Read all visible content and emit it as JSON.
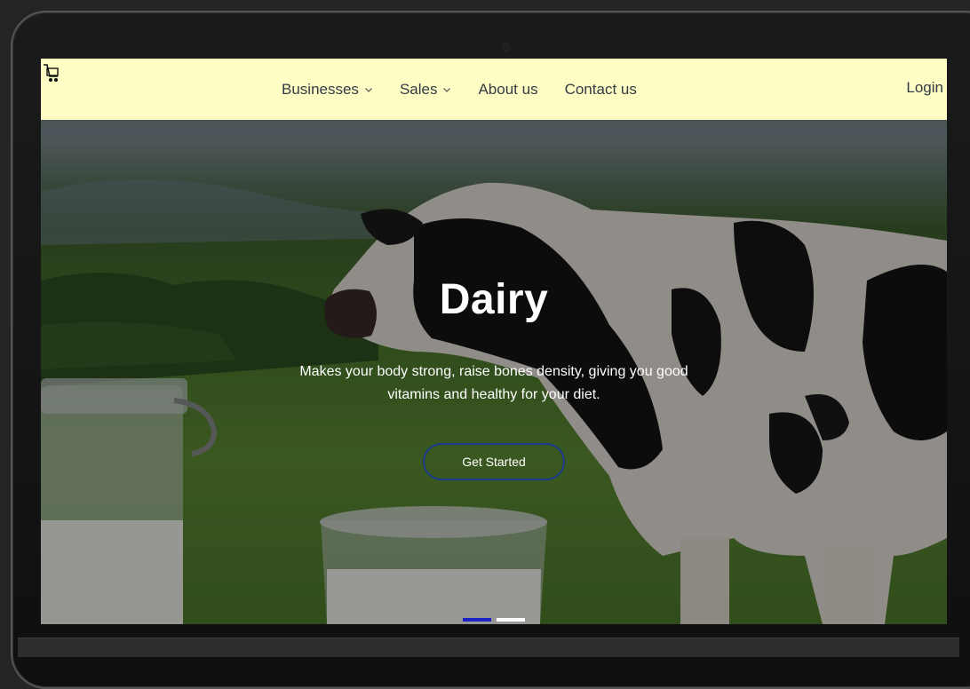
{
  "nav": {
    "items": [
      {
        "label": "Businesses",
        "has_dropdown": true
      },
      {
        "label": "Sales",
        "has_dropdown": true
      },
      {
        "label": "About us",
        "has_dropdown": false
      },
      {
        "label": "Contact us",
        "has_dropdown": false
      }
    ],
    "login_label": "Login"
  },
  "hero": {
    "title": "Dairy",
    "subtitle": "Makes your body strong, raise bones density, giving you good vitamins and healthy for your diet.",
    "cta_label": "Get Started"
  },
  "carousel": {
    "slide_count": 2,
    "active_index": 0
  },
  "colors": {
    "navbar_bg": "#fefdc4",
    "nav_text": "#333b47",
    "cta_border": "#1e3a8a",
    "indicator_active": "#1d22c8",
    "indicator_inactive": "#ffffff"
  },
  "icons": {
    "logo": "cart-logo-icon",
    "dropdown": "chevron-down-icon"
  }
}
